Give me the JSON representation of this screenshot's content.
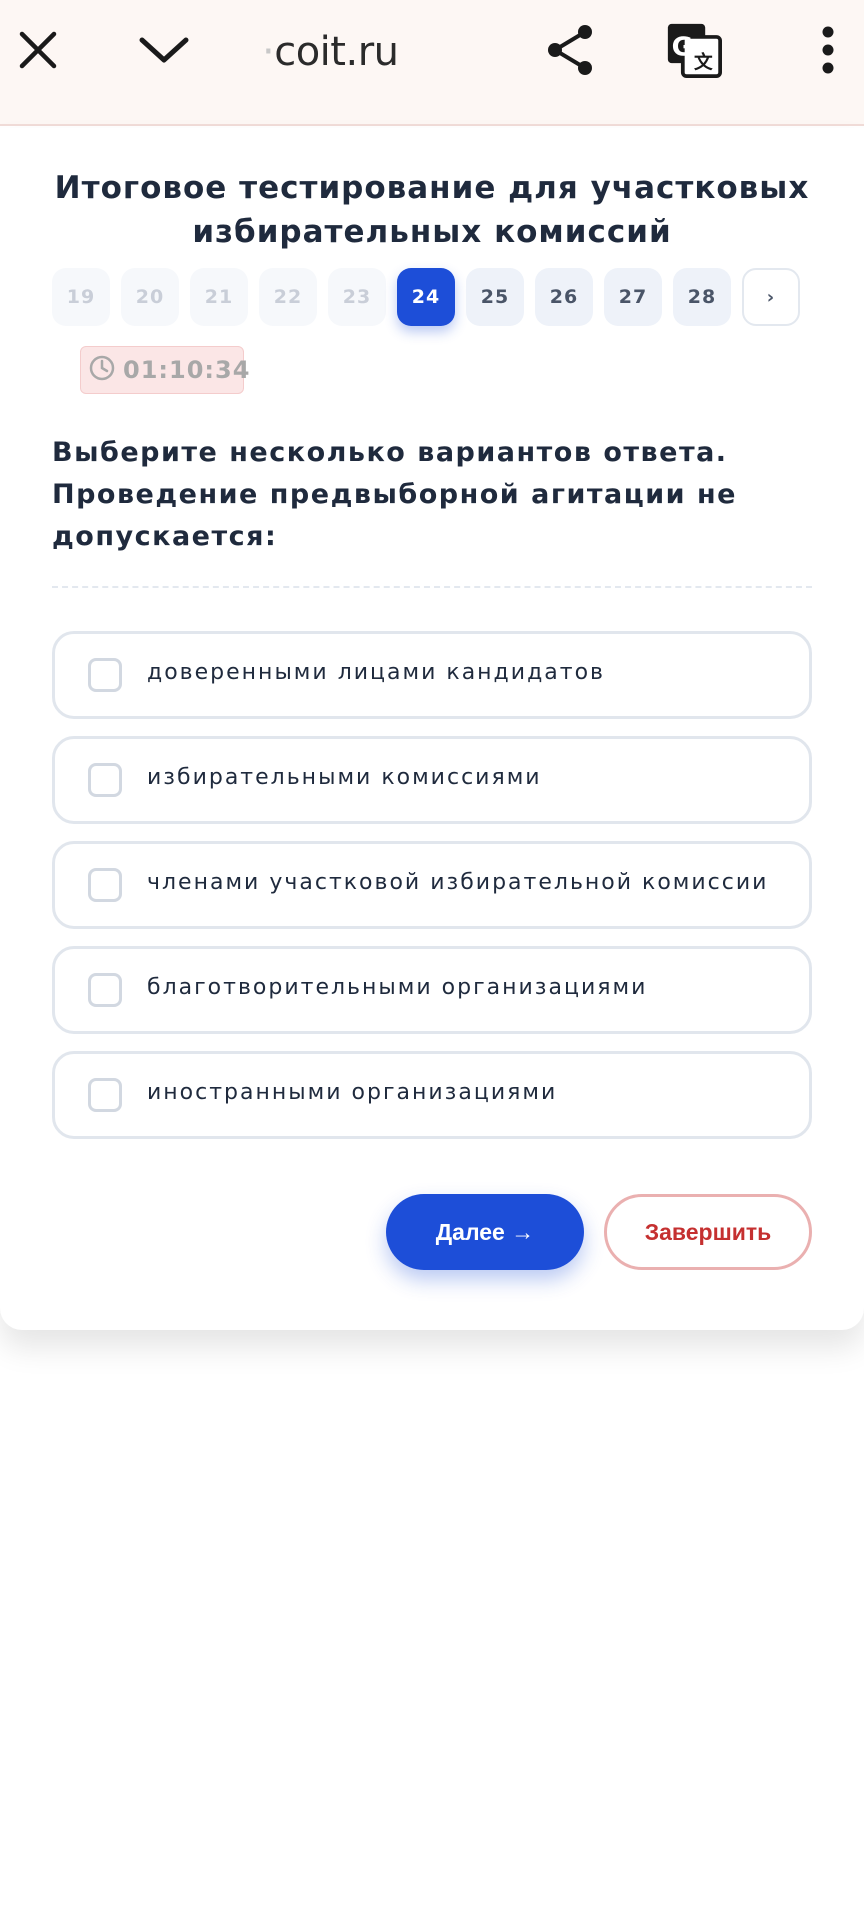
{
  "browser": {
    "url_faded_prefix": "·",
    "url": "coit.ru"
  },
  "test": {
    "title": "Итоговое тестирование для участковых избирательных комиссий",
    "pages": [
      "19",
      "20",
      "21",
      "22",
      "23",
      "24",
      "25",
      "26",
      "27",
      "28"
    ],
    "current_page": "24",
    "next_page_label": "›",
    "timer": "01:10:34",
    "question": "Выберите несколько вариантов ответа. Проведение предвыборной агитации не допускается:",
    "options": [
      "доверенными лицами кандидатов",
      "избирательными комиссиями",
      "членами участковой избирательной комиссии",
      "благотворительными организациями",
      "иностранными организациями"
    ],
    "next_button": "Далее →",
    "finish_button": "Завершить"
  },
  "colors": {
    "accent": "#1d4ed8",
    "danger": "#c53030",
    "timer_bg": "#fbe6e6"
  }
}
